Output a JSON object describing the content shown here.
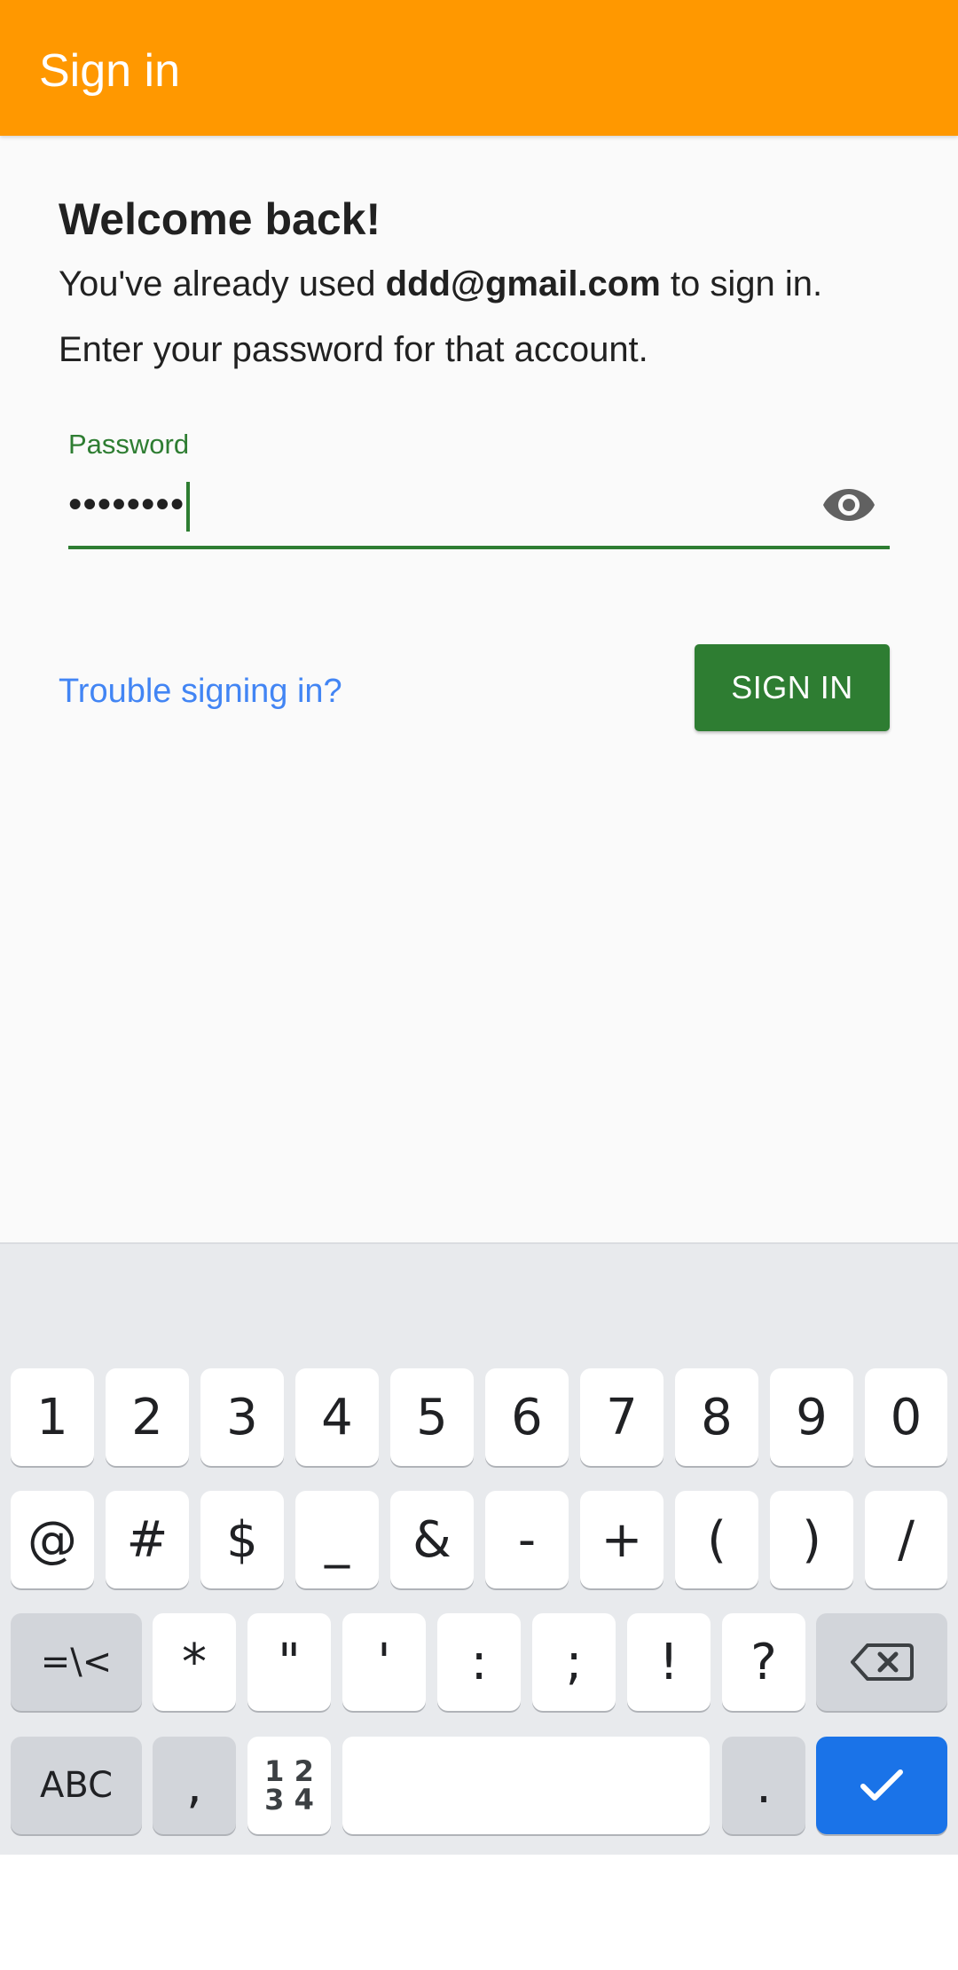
{
  "appbar": {
    "title": "Sign in"
  },
  "welcome": {
    "heading": "Welcome back!",
    "msg_prefix": "You've already used ",
    "email": "ddd@gmail.com",
    "msg_suffix": " to sign in. Enter your password for that account."
  },
  "password": {
    "label": "Password",
    "value": "••••••••",
    "toggle_icon": "eye-icon"
  },
  "actions": {
    "trouble_label": "Trouble signing in?",
    "signin_label": "SIGN IN"
  },
  "keyboard": {
    "row1": [
      "1",
      "2",
      "3",
      "4",
      "5",
      "6",
      "7",
      "8",
      "9",
      "0"
    ],
    "row2": [
      "@",
      "#",
      "$",
      "_",
      "&",
      "-",
      "+",
      "(",
      ")",
      "/"
    ],
    "row3": [
      "=\\<",
      "*",
      "\"",
      "'",
      ":",
      ";",
      "!",
      "?"
    ],
    "row4": {
      "abc": "ABC",
      "comma": ",",
      "num_top": "1 2",
      "num_bottom": "3 4",
      "period": "."
    }
  },
  "colors": {
    "appbar": "#ff9800",
    "accent": "#2e7d32",
    "link": "#4285f4",
    "enter_key": "#1a73e8"
  }
}
